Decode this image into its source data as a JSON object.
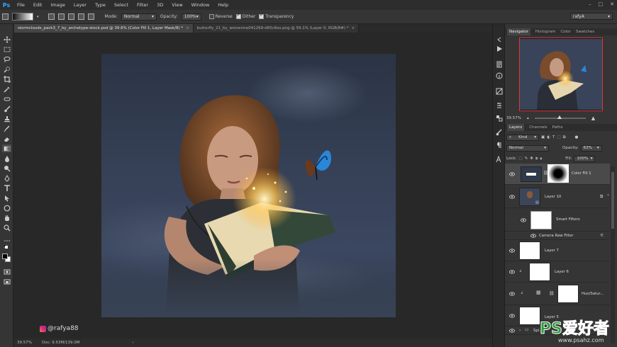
{
  "app": {
    "logo": "Ps"
  },
  "menu": [
    "File",
    "Edit",
    "Image",
    "Layer",
    "Type",
    "Select",
    "Filter",
    "3D",
    "View",
    "Window",
    "Help"
  ],
  "options": {
    "mode_label": "Mode:",
    "mode_value": "Normal",
    "opacity_label": "Opacity:",
    "opacity_value": "100%",
    "reverse_label": "Reverse",
    "dither_label": "Dither",
    "transparency_label": "Transparency",
    "workspace": "rafyA"
  },
  "tabs": [
    {
      "label": "stormclouds_pack3_7_by_archetype-stock.psd @ 39.6% (Color Fill 1, Layer Mask/8) *",
      "active": true
    },
    {
      "label": "butterfly_21_by_wolverine041269-d65c6os.png @ 59.1% (Layer 0, RGB/8#) *",
      "active": false
    }
  ],
  "canvas": {
    "watermark": "@rafya88"
  },
  "status": {
    "zoom": "39.57%",
    "doc": "Doc: 9.53M/139.0M"
  },
  "navigator": {
    "tabs": [
      "Navigator",
      "Histogram",
      "Color",
      "Swatches"
    ],
    "zoom": "39.57%"
  },
  "layers_panel": {
    "tabs": [
      "Layers",
      "Channels",
      "Paths"
    ],
    "filter_kind": "Kind",
    "blend_mode": "Normal",
    "opacity_label": "Opacity:",
    "opacity_value": "63%",
    "lock_label": "Lock:",
    "fill_label": "Fill:",
    "fill_value": "100%",
    "layers": [
      {
        "name": "Color Fill 1"
      },
      {
        "name": "Layer 10"
      },
      {
        "name": "Smart Filters"
      },
      {
        "name": "Camera Raw Filter"
      },
      {
        "name": "Layer 7"
      },
      {
        "name": "Layer 6"
      },
      {
        "name": "Hue/Satur..."
      },
      {
        "name": "Layer 5"
      },
      {
        "name": "Spi..."
      }
    ]
  },
  "site_logo": {
    "main": "PS爱好者",
    "sub": "www.psahz.com"
  }
}
